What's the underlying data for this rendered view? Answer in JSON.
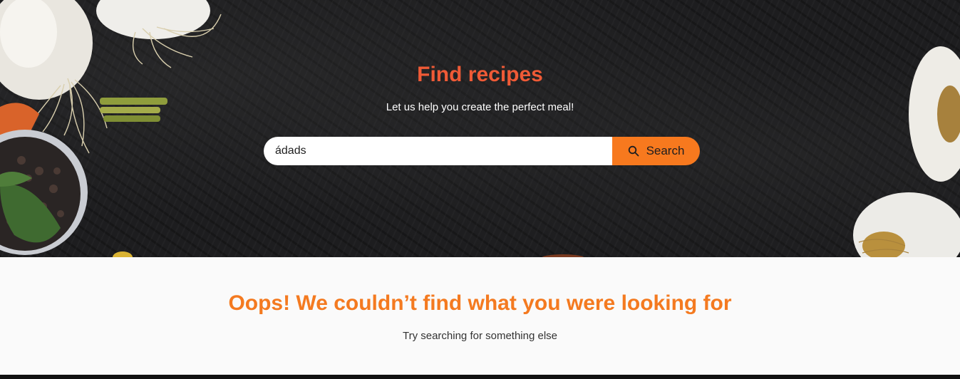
{
  "hero": {
    "title": "Find recipes",
    "subtitle": "Let us help you create the perfect meal!",
    "title_color": "#ef5a36",
    "background_color": "#1d1d1f"
  },
  "search": {
    "value": "ádads",
    "placeholder": "",
    "button_label": "Search",
    "button_icon": "search-icon",
    "button_color": "#f7791e"
  },
  "results": {
    "empty_title": "Oops! We couldn’t find what you were looking for",
    "empty_hint": "Try searching for something else",
    "title_color": "#f47a20"
  }
}
